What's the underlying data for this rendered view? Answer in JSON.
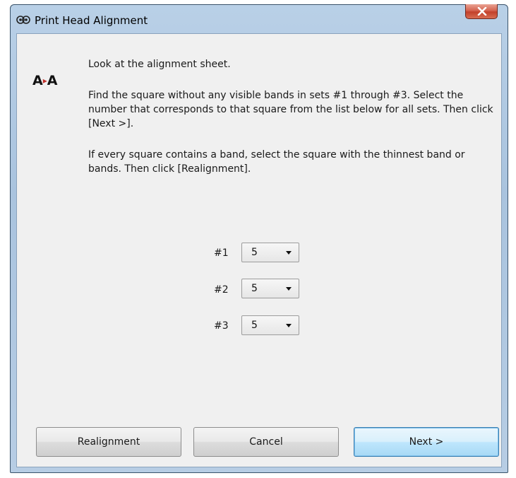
{
  "window": {
    "title": "Print Head Alignment",
    "close_label": "x"
  },
  "icon": {
    "alignment_icon_text_left": "A",
    "alignment_icon_text_right": "A",
    "alignment_icon_arrow": "▸"
  },
  "instructions": {
    "line1": "Look at the alignment sheet.",
    "line2": "Find the square without any visible bands in sets #1 through #3. Select the number that corresponds to that square from the list below for all sets. Then click [Next >].",
    "line3": "If every square contains a band, select the square with the thinnest band or bands. Then click [Realignment]."
  },
  "sets": [
    {
      "label": "#1",
      "value": "5"
    },
    {
      "label": "#2",
      "value": "5"
    },
    {
      "label": "#3",
      "value": "5"
    }
  ],
  "buttons": {
    "realignment": "Realignment",
    "cancel": "Cancel",
    "next": "Next >"
  },
  "colors": {
    "title_bar": "#b9d0e7",
    "client_bg": "#f0f0f0",
    "close_button": "#d5634f",
    "default_button_border": "#3c7fb1"
  }
}
